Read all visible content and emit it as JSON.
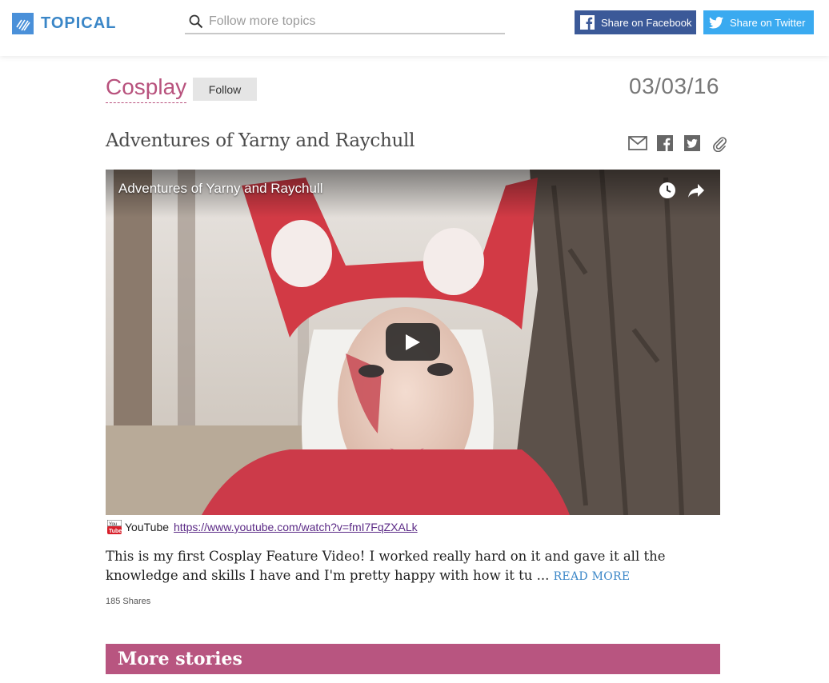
{
  "header": {
    "logo_text": "TOPICAL",
    "search_placeholder": "Follow more topics",
    "share_facebook": "Share on Facebook",
    "share_twitter": "Share on Twitter"
  },
  "topic": {
    "name": "Cosplay",
    "follow_label": "Follow",
    "date": "03/03/16"
  },
  "article": {
    "title": "Adventures of Yarny and Raychull",
    "video_title": "Adventures of Yarny and Raychull",
    "source_name": "YouTube",
    "source_url": "https://www.youtube.com/watch?v=fmI7FqZXALk",
    "description": "This is my first Cosplay Feature Video! I worked really hard on it and gave it all the knowledge and skills I have and I'm pretty happy with how it tu ...",
    "read_more": "READ MORE",
    "shares": "185 Shares"
  },
  "more_stories": {
    "title": "More stories"
  },
  "colors": {
    "accent_pink": "#b8527d",
    "brand_blue": "#3a86c7",
    "facebook_blue": "#3b5998",
    "twitter_blue": "#3aaaf0"
  }
}
